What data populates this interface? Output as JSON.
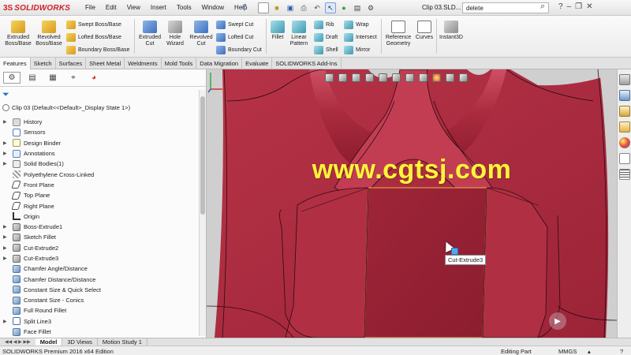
{
  "app": {
    "brand_mark": "3S",
    "brand_name": "SOLIDWORKS",
    "document_title": "Clip 03.SLD...",
    "search_value": "delete"
  },
  "menus": [
    "File",
    "Edit",
    "View",
    "Insert",
    "Tools",
    "Window",
    "Help"
  ],
  "ribbon": {
    "extruded_boss": "Extruded\nBoss/Base",
    "revolved_boss": "Revolved\nBoss/Base",
    "swept_boss": "Swept Boss/Base",
    "lofted_boss": "Lofted Boss/Base",
    "boundary_boss": "Boundary Boss/Base",
    "extruded_cut": "Extruded\nCut",
    "hole_wizard": "Hole\nWizard",
    "revolved_cut": "Revolved\nCut",
    "swept_cut": "Swept Cut",
    "lofted_cut": "Lofted Cut",
    "boundary_cut": "Boundary Cut",
    "fillet": "Fillet",
    "linear_pattern": "Linear\nPattern",
    "rib": "Rib",
    "draft": "Draft",
    "shell": "Shell",
    "wrap": "Wrap",
    "intersect": "Intersect",
    "mirror": "Mirror",
    "reference_geometry": "Reference\nGeometry",
    "curves": "Curves",
    "instant3d": "Instant3D"
  },
  "command_tabs": [
    "Features",
    "Sketch",
    "Surfaces",
    "Sheet Metal",
    "Weldments",
    "Mold Tools",
    "Data Migration",
    "Evaluate",
    "SOLIDWORKS Add-Ins"
  ],
  "feature_manager": {
    "root": "Clip 03  (Default<<Default>_Display State 1>)",
    "items": [
      {
        "label": "History",
        "icon": "hist",
        "expandable": true
      },
      {
        "label": "Sensors",
        "icon": "sens",
        "expandable": false
      },
      {
        "label": "Design Binder",
        "icon": "bind",
        "expandable": true
      },
      {
        "label": "Annotations",
        "icon": "anno",
        "expandable": true
      },
      {
        "label": "Solid Bodies(1)",
        "icon": "solid",
        "expandable": true
      },
      {
        "label": "Polyethylene Cross-Linked",
        "icon": "mat",
        "expandable": false
      },
      {
        "label": "Front Plane",
        "icon": "plane",
        "expandable": false
      },
      {
        "label": "Top Plane",
        "icon": "plane",
        "expandable": false
      },
      {
        "label": "Right Plane",
        "icon": "plane",
        "expandable": false
      },
      {
        "label": "Origin",
        "icon": "origin",
        "expandable": false
      },
      {
        "label": "Boss-Extrude1",
        "icon": "feat",
        "expandable": true
      },
      {
        "label": "Sketch Fillet",
        "icon": "feat",
        "expandable": true
      },
      {
        "label": "Cut-Extrude2",
        "icon": "feat",
        "expandable": true
      },
      {
        "label": "Cut-Extrude3",
        "icon": "feat",
        "expandable": true
      },
      {
        "label": "Chamfer Angle/Distance",
        "icon": "fillet",
        "expandable": false
      },
      {
        "label": "Chamfer Distance/Distance",
        "icon": "fillet",
        "expandable": false
      },
      {
        "label": "Constant Size & Quick Select",
        "icon": "fillet",
        "expandable": false
      },
      {
        "label": "Constant Size - Conics",
        "icon": "fillet",
        "expandable": false
      },
      {
        "label": "Full Round Fillet",
        "icon": "fillet",
        "expandable": false
      },
      {
        "label": "Split Line3",
        "icon": "split",
        "expandable": true
      },
      {
        "label": "Face Fillet",
        "icon": "fillet",
        "expandable": false
      }
    ]
  },
  "viewport": {
    "tooltip": "Cut-Extrude3",
    "watermark": "www.cgtsj.com",
    "model_color": "#a8293b"
  },
  "bottom_tabs": [
    "Model",
    "3D Views",
    "Motion Study 1"
  ],
  "status": {
    "edition": "SOLIDWORKS Premium 2016 x64 Edition",
    "mode": "Editing Part",
    "units": "MMGS"
  }
}
